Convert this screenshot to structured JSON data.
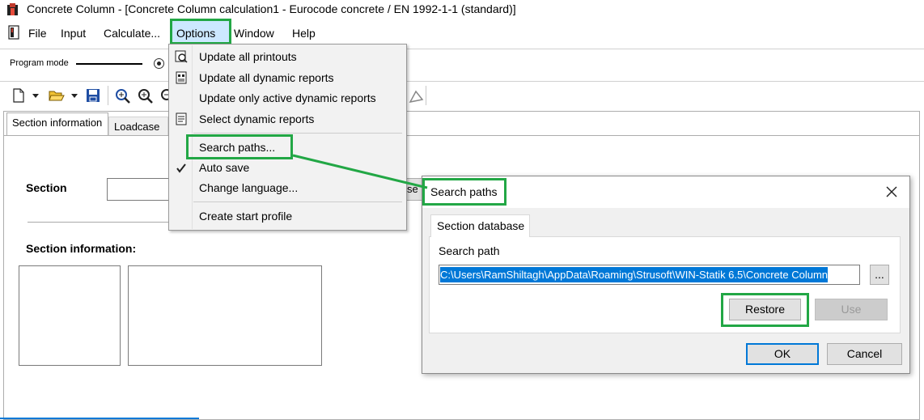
{
  "window": {
    "title": "Concrete Column - [Concrete Column calculation1 - Eurocode concrete / EN 1992-1-1 (standard)]"
  },
  "menubar": {
    "items": [
      {
        "label": "File"
      },
      {
        "label": "Input"
      },
      {
        "label": "Calculate..."
      },
      {
        "label": "Options",
        "active": true
      },
      {
        "label": "Window"
      },
      {
        "label": "Help"
      }
    ]
  },
  "program_mode": {
    "label": "Program mode"
  },
  "options_menu": {
    "items": [
      {
        "label": "Update all printouts",
        "icon": "printer-refresh-icon"
      },
      {
        "label": "Update all dynamic reports",
        "icon": "report-refresh-icon"
      },
      {
        "label": "Update only active dynamic reports",
        "icon": ""
      },
      {
        "label": "Select dynamic reports",
        "icon": "report-select-icon"
      },
      {
        "label": "Search paths...",
        "icon": "",
        "highlighted": true
      },
      {
        "label": "Auto save",
        "icon": "checkmark-icon",
        "checked": true
      },
      {
        "label": "Change language...",
        "icon": ""
      },
      {
        "label": "Create start profile",
        "icon": ""
      }
    ]
  },
  "main": {
    "tabs": [
      {
        "label": "Section information",
        "selected": true
      },
      {
        "label": "Loadcase",
        "selected": false
      }
    ],
    "section_label": "Section",
    "section_value": "",
    "section_info_label": "Section information:",
    "partial_button_text": "se"
  },
  "dialog": {
    "title": "Search paths",
    "tab": "Section database",
    "search_path_label": "Search path",
    "search_path_value": "C:\\Users\\RamShiltagh\\AppData\\Roaming\\Strusoft\\WIN-Statik 6.5\\Concrete Column",
    "browse_label": "...",
    "restore_label": "Restore",
    "use_label": "Use",
    "ok_label": "OK",
    "cancel_label": "Cancel"
  },
  "colors": {
    "highlight_green": "#22a745",
    "selection_blue": "#0078d7",
    "menu_active": "#cce8ff"
  }
}
